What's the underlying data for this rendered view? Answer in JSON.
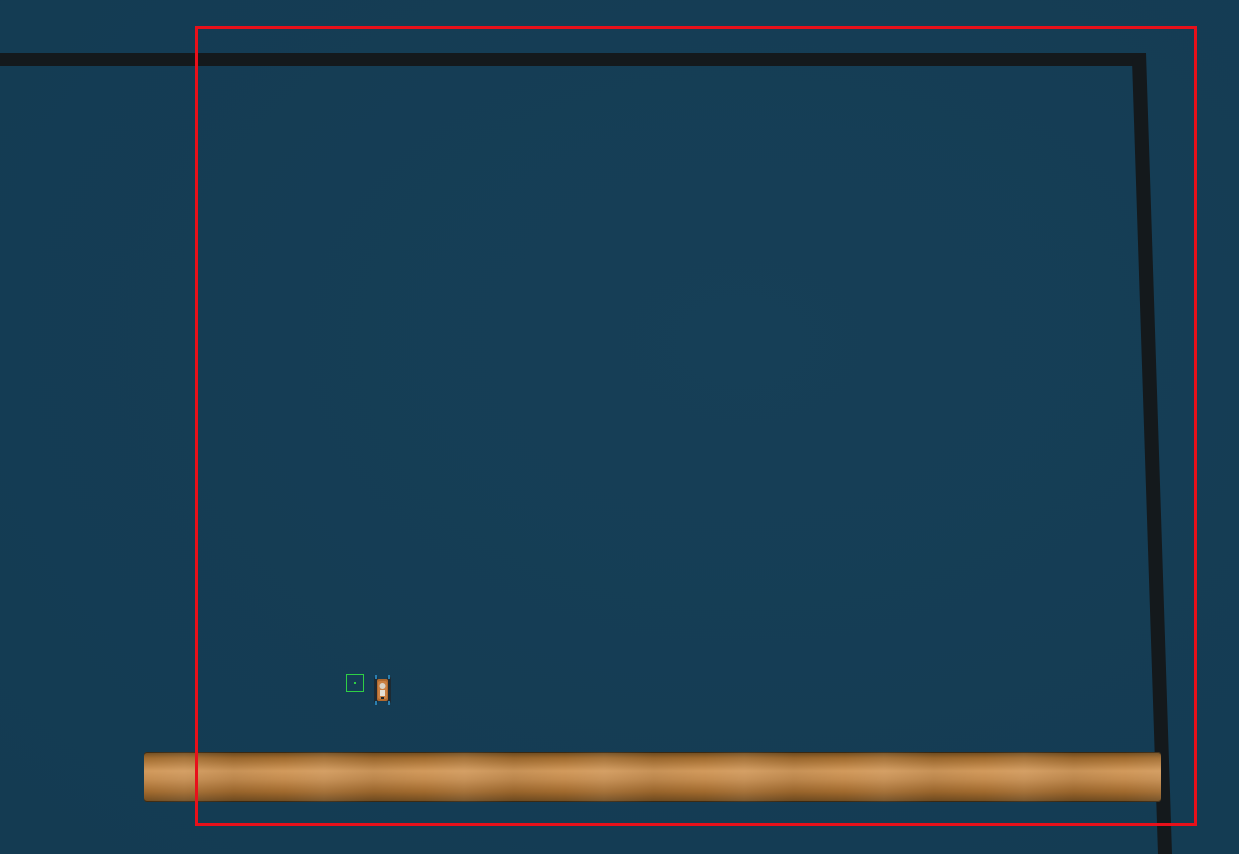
{
  "scene": {
    "type": "top-down simulation view",
    "background_color": "#163f57",
    "wall_color": "#14191c",
    "plank_color": "#c48c4f",
    "bounding_box_color": "#e8101a",
    "target_color": "#2ecf45"
  },
  "objects": {
    "wall": "boundary-wall",
    "plank": "wooden-plank",
    "target": "target-marker",
    "robot": "robot-icon",
    "selection": "bounding-box"
  }
}
